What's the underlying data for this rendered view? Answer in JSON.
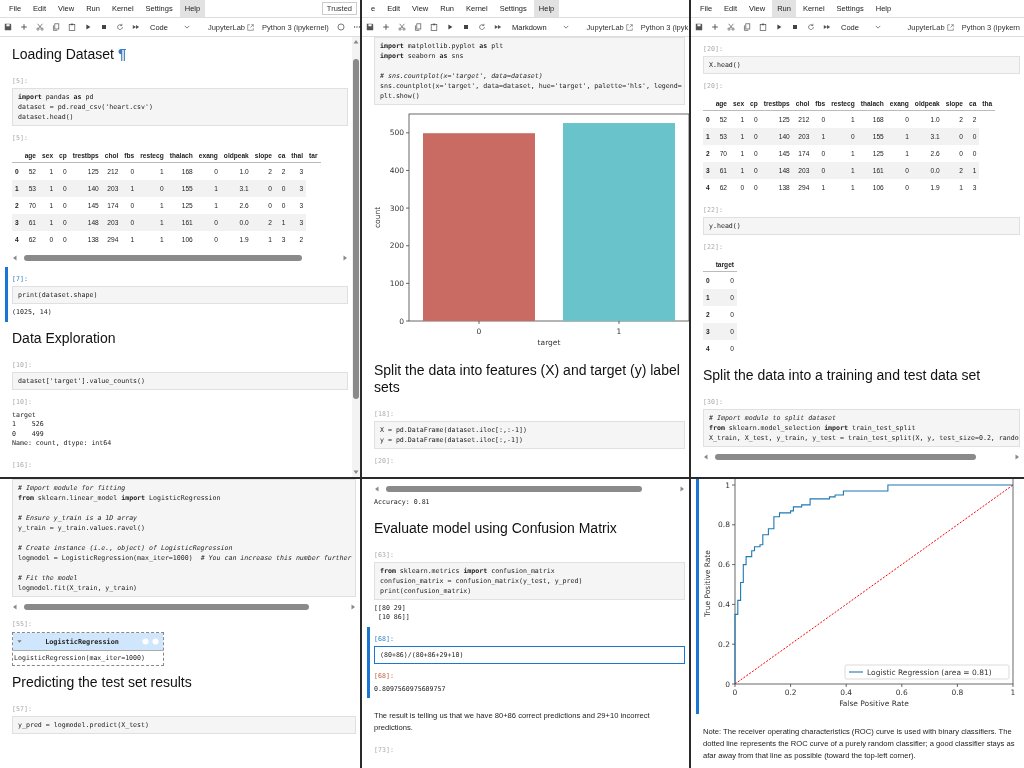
{
  "panels": [
    {
      "menu": {
        "items": [
          {
            "label": "File",
            "selected": false
          },
          {
            "label": "Edit",
            "selected": false
          },
          {
            "label": "View",
            "selected": false
          },
          {
            "label": "Run",
            "selected": false
          },
          {
            "label": "Kernel",
            "selected": false
          },
          {
            "label": "Settings",
            "selected": false
          },
          {
            "label": "Help",
            "selected": true
          }
        ],
        "trusted": "Trusted"
      },
      "toolbar": {
        "cell_type": "Code",
        "open_label": "JupyterLab",
        "kernel": "Python 3 (ipykernel)",
        "indicator": true
      },
      "scrollbar": true,
      "cells": [
        {
          "selected": false,
          "blocks": [
            {
              "kind": "heading",
              "text": "Loading Dataset",
              "anchor": "¶"
            }
          ]
        },
        {
          "selected": false,
          "blocks": [
            {
              "kind": "in_prompt",
              "text": "[5]:"
            },
            {
              "kind": "code",
              "groups": [
                [
                  "**import** pandas **as** pd",
                  "dataset = pd.read_csv('heart.csv')",
                  "dataset.head()"
                ]
              ]
            },
            {
              "kind": "out_prompt",
              "text": "[5]:"
            },
            {
              "kind": "table",
              "columns": [
                "age",
                "sex",
                "cp",
                "trestbps",
                "chol",
                "fbs",
                "restecg",
                "thalach",
                "exang",
                "oldpeak",
                "slope",
                "ca",
                "thal",
                "tar"
              ],
              "rows": [
                {
                  "index": "0",
                  "cells": [
                    "52",
                    "1",
                    "0",
                    "125",
                    "212",
                    "0",
                    "1",
                    "168",
                    "0",
                    "1.0",
                    "2",
                    "2",
                    "3"
                  ]
                },
                {
                  "index": "1",
                  "cells": [
                    "53",
                    "1",
                    "0",
                    "140",
                    "203",
                    "1",
                    "0",
                    "155",
                    "1",
                    "3.1",
                    "0",
                    "0",
                    "3"
                  ]
                },
                {
                  "index": "2",
                  "cells": [
                    "70",
                    "1",
                    "0",
                    "145",
                    "174",
                    "0",
                    "1",
                    "125",
                    "1",
                    "2.6",
                    "0",
                    "0",
                    "3"
                  ]
                },
                {
                  "index": "3",
                  "cells": [
                    "61",
                    "1",
                    "0",
                    "148",
                    "203",
                    "0",
                    "1",
                    "161",
                    "0",
                    "0.0",
                    "2",
                    "1",
                    "3"
                  ]
                },
                {
                  "index": "4",
                  "cells": [
                    "62",
                    "0",
                    "0",
                    "138",
                    "294",
                    "1",
                    "1",
                    "106",
                    "0",
                    "1.9",
                    "1",
                    "3",
                    "2"
                  ]
                }
              ]
            },
            {
              "kind": "hscroll"
            }
          ]
        },
        {
          "selected": true,
          "blocks": [
            {
              "kind": "in_prompt",
              "text": "[7]:"
            },
            {
              "kind": "code",
              "groups": [
                [
                  "print(dataset.shape)"
                ]
              ]
            },
            {
              "kind": "output",
              "lines": [
                "(1025, 14)"
              ]
            }
          ]
        },
        {
          "selected": false,
          "blocks": [
            {
              "kind": "heading",
              "text": "Data Exploration"
            }
          ]
        },
        {
          "selected": false,
          "blocks": [
            {
              "kind": "in_prompt",
              "text": "[10]:"
            },
            {
              "kind": "code",
              "groups": [
                [
                  "dataset['target'].value_counts()"
                ]
              ]
            },
            {
              "kind": "out_prompt",
              "text": "[10]:"
            },
            {
              "kind": "output",
              "lines": [
                "target",
                "1    526",
                "0    499",
                "Name: count, dtype: int64"
              ]
            }
          ]
        },
        {
          "selected": false,
          "blocks": [
            {
              "kind": "in_prompt",
              "text": "[16]:"
            }
          ]
        }
      ]
    },
    {
      "menu": {
        "items": [
          {
            "label": "e",
            "selected": false
          },
          {
            "label": "Edit",
            "selected": false
          },
          {
            "label": "View",
            "selected": false
          },
          {
            "label": "Run",
            "selected": false
          },
          {
            "label": "Kernel",
            "selected": false
          },
          {
            "label": "Settings",
            "selected": false
          },
          {
            "label": "Help",
            "selected": true
          }
        ]
      },
      "toolbar": {
        "cell_type": "Markdown",
        "open_label": "JupyterLab",
        "kernel": "Python 3 (ipyk"
      },
      "cells": [
        {
          "selected": false,
          "blocks": [
            {
              "kind": "code",
              "groups": [
                [
                  "**import** matplotlib.pyplot **as** plt",
                  "**import** seaborn **as** sns"
                ],
                [
                  "*# sns.countplot(x='target', data=dataset)*",
                  "sns.countplot(x='target', data=dataset, hue='target', palette='hls', legend=",
                  "plt.show()"
                ]
              ]
            },
            {
              "kind": "chart",
              "chart_data": {
                "type": "bar",
                "xlabel": "target",
                "ylabel": "count",
                "categories": [
                  "0",
                  "1"
                ],
                "series": [
                  {
                    "color": "#c96a63",
                    "values": [
                      499,
                      null
                    ]
                  },
                  {
                    "color": "#68c4ca",
                    "values": [
                      null,
                      526
                    ]
                  }
                ],
                "ylim": [
                  0,
                  550
                ],
                "yticks": [
                  0,
                  100,
                  200,
                  300,
                  400,
                  500
                ]
              }
            }
          ]
        },
        {
          "selected": false,
          "blocks": [
            {
              "kind": "heading",
              "text": "Split the data into features (X) and target (y) label sets"
            }
          ]
        },
        {
          "selected": false,
          "blocks": [
            {
              "kind": "in_prompt",
              "text": "[18]:"
            },
            {
              "kind": "code",
              "groups": [
                [
                  "X = pd.DataFrame(dataset.iloc[:,:-1])",
                  "y = pd.DataFrame(dataset.iloc[:,-1])"
                ]
              ]
            }
          ]
        },
        {
          "selected": false,
          "blocks": [
            {
              "kind": "in_prompt",
              "text": "[20]:"
            }
          ]
        }
      ]
    },
    {
      "menu": {
        "items": [
          {
            "label": "File",
            "selected": false
          },
          {
            "label": "Edit",
            "selected": false
          },
          {
            "label": "View",
            "selected": false
          },
          {
            "label": "Run",
            "selected": true
          },
          {
            "label": "Kernel",
            "selected": false
          },
          {
            "label": "Settings",
            "selected": false
          },
          {
            "label": "Help",
            "selected": false
          }
        ]
      },
      "toolbar": {
        "cell_type": "Code",
        "open_label": "JupyterLab",
        "kernel": "Python 3 (ipykern"
      },
      "cells": [
        {
          "selected": false,
          "blocks": [
            {
              "kind": "in_prompt",
              "text": "[20]:"
            },
            {
              "kind": "code",
              "groups": [
                [
                  "X.head()"
                ]
              ]
            },
            {
              "kind": "out_prompt",
              "text": "[20]:"
            },
            {
              "kind": "table",
              "columns": [
                "age",
                "sex",
                "cp",
                "trestbps",
                "chol",
                "fbs",
                "restecg",
                "thalach",
                "exang",
                "oldpeak",
                "slope",
                "ca",
                "tha"
              ],
              "rows": [
                {
                  "index": "0",
                  "cells": [
                    "52",
                    "1",
                    "0",
                    "125",
                    "212",
                    "0",
                    "1",
                    "168",
                    "0",
                    "1.0",
                    "2",
                    "2"
                  ]
                },
                {
                  "index": "1",
                  "cells": [
                    "53",
                    "1",
                    "0",
                    "140",
                    "203",
                    "1",
                    "0",
                    "155",
                    "1",
                    "3.1",
                    "0",
                    "0"
                  ]
                },
                {
                  "index": "2",
                  "cells": [
                    "70",
                    "1",
                    "0",
                    "145",
                    "174",
                    "0",
                    "1",
                    "125",
                    "1",
                    "2.6",
                    "0",
                    "0"
                  ]
                },
                {
                  "index": "3",
                  "cells": [
                    "61",
                    "1",
                    "0",
                    "148",
                    "203",
                    "0",
                    "1",
                    "161",
                    "0",
                    "0.0",
                    "2",
                    "1"
                  ]
                },
                {
                  "index": "4",
                  "cells": [
                    "62",
                    "0",
                    "0",
                    "138",
                    "294",
                    "1",
                    "1",
                    "106",
                    "0",
                    "1.9",
                    "1",
                    "3"
                  ]
                }
              ]
            }
          ]
        },
        {
          "selected": false,
          "blocks": [
            {
              "kind": "in_prompt",
              "text": "[22]:"
            },
            {
              "kind": "code",
              "groups": [
                [
                  "y.head()"
                ]
              ]
            },
            {
              "kind": "out_prompt",
              "text": "[22]:"
            },
            {
              "kind": "table",
              "columns": [
                "target"
              ],
              "rows": [
                {
                  "index": "0",
                  "cells": [
                    "0"
                  ]
                },
                {
                  "index": "1",
                  "cells": [
                    "0"
                  ]
                },
                {
                  "index": "2",
                  "cells": [
                    "0"
                  ]
                },
                {
                  "index": "3",
                  "cells": [
                    "0"
                  ]
                },
                {
                  "index": "4",
                  "cells": [
                    "0"
                  ]
                }
              ]
            }
          ]
        },
        {
          "selected": false,
          "blocks": [
            {
              "kind": "heading",
              "text": "Split the data into a training and test data set"
            }
          ]
        },
        {
          "selected": false,
          "blocks": [
            {
              "kind": "in_prompt",
              "text": "[30]:"
            },
            {
              "kind": "code",
              "groups": [
                [
                  "*# Import module to split dataset*",
                  "**from** sklearn.model_selection **import** train_test_split",
                  "X_train, X_test, y_train, y_test = train_test_split(X, y, test_size=0.2, rando"
                ]
              ]
            },
            {
              "kind": "hscroll"
            }
          ]
        }
      ]
    },
    {
      "cells": [
        {
          "selected": false,
          "blocks": [
            {
              "kind": "code",
              "groups": [
                [
                  "*# Import module for fitting*",
                  "**from** sklearn.linear_model **import** LogisticRegression"
                ],
                [
                  "*# Ensure y_train is a 1D array*",
                  "y_train = y_train.values.ravel()"
                ],
                [
                  "*# Create instance (i.e., object) of LogisticRegression*",
                  "logmodel = LogisticRegression(max_iter=1000)  *# You can increase this number further*"
                ],
                [
                  "*# Fit the model*",
                  "logmodel.fit(X_train, y_train)"
                ]
              ]
            },
            {
              "kind": "hscroll"
            },
            {
              "kind": "out_prompt",
              "text": "[55]:"
            },
            {
              "kind": "widget",
              "title": "LogisticRegression",
              "body": "LogisticRegression(max_iter=1000)"
            }
          ]
        },
        {
          "selected": false,
          "blocks": [
            {
              "kind": "heading",
              "text": "Predicting the test set results"
            }
          ]
        },
        {
          "selected": false,
          "blocks": [
            {
              "kind": "in_prompt",
              "text": "[57]:"
            },
            {
              "kind": "code",
              "groups": [
                [
                  "y_pred = logmodel.predict(X_test)"
                ]
              ]
            }
          ]
        }
      ]
    },
    {
      "cells": [
        {
          "selected": false,
          "blocks": [
            {
              "kind": "hscroll"
            },
            {
              "kind": "output",
              "lines": [
                "Accuracy: 0.81"
              ]
            }
          ]
        },
        {
          "selected": false,
          "blocks": [
            {
              "kind": "heading",
              "text": "Evaluate model using Confusion Matrix"
            }
          ]
        },
        {
          "selected": false,
          "blocks": [
            {
              "kind": "in_prompt",
              "text": "[63]:"
            },
            {
              "kind": "code",
              "groups": [
                [
                  "**from** sklearn.metrics **import** confusion_matrix",
                  "confusion_matrix = confusion_matrix(y_test, y_pred)",
                  "print(confusion_matrix)"
                ]
              ]
            },
            {
              "kind": "output",
              "lines": [
                "[[80 29]",
                " [10 86]]"
              ]
            }
          ]
        },
        {
          "selected": true,
          "blocks": [
            {
              "kind": "in_prompt",
              "text": "[68]:"
            },
            {
              "kind": "code",
              "focused": true,
              "groups": [
                [
                  "(80+86)/(80+86+29+10)"
                ]
              ]
            },
            {
              "kind": "out_prompt",
              "text": "[68]:"
            },
            {
              "kind": "output",
              "lines": [
                "0.8097560975609757"
              ]
            }
          ]
        },
        {
          "selected": false,
          "blocks": [
            {
              "kind": "text",
              "text": "The result is telling us that we have 80+86 correct predictions and 29+10 incorrect predictions."
            }
          ]
        },
        {
          "selected": false,
          "blocks": [
            {
              "kind": "in_prompt",
              "text": "[73]:"
            }
          ]
        }
      ]
    },
    {
      "cells": [
        {
          "selected": true,
          "blocks": [
            {
              "kind": "chart",
              "chart_data": {
                "type": "line",
                "xlabel": "False Positive Rate",
                "ylabel": "True Positive Rate",
                "xlim": [
                  0,
                  1
                ],
                "ylim": [
                  0,
                  1.05
                ],
                "xticks": [
                  0,
                  0.2,
                  0.4,
                  0.6,
                  0.8,
                  1
                ],
                "yticks": [
                  0,
                  0.2,
                  0.4,
                  0.6,
                  0.8,
                  1
                ],
                "x": [
                  0,
                  0,
                  0.01,
                  0.01,
                  0.02,
                  0.02,
                  0.03,
                  0.03,
                  0.04,
                  0.04,
                  0.06,
                  0.06,
                  0.07,
                  0.07,
                  0.09,
                  0.09,
                  0.1,
                  0.1,
                  0.12,
                  0.12,
                  0.14,
                  0.14,
                  0.16,
                  0.16,
                  0.2,
                  0.2,
                  0.21,
                  0.21,
                  0.24,
                  0.24,
                  0.27,
                  0.27,
                  0.34,
                  0.34,
                  0.36,
                  0.36,
                  0.39,
                  0.39,
                  0.55,
                  0.55,
                  1
                ],
                "series": [
                  {
                    "name": "Logistic Regression (area = 0.81)",
                    "color": "#1f77b4",
                    "line_style": "solid",
                    "values": [
                      0,
                      0.35,
                      0.35,
                      0.42,
                      0.42,
                      0.51,
                      0.51,
                      0.6,
                      0.6,
                      0.64,
                      0.64,
                      0.67,
                      0.67,
                      0.69,
                      0.69,
                      0.7,
                      0.7,
                      0.75,
                      0.75,
                      0.78,
                      0.78,
                      0.84,
                      0.84,
                      0.86,
                      0.86,
                      0.87,
                      0.87,
                      0.89,
                      0.89,
                      0.9,
                      0.9,
                      0.93,
                      0.93,
                      0.94,
                      0.94,
                      0.95,
                      0.95,
                      0.97,
                      0.97,
                      1,
                      1
                    ]
                  },
                  {
                    "color": "#ff0000",
                    "line_style": "dashed",
                    "values": [
                      0,
                      0,
                      0.01,
                      0.01,
                      0.02,
                      0.02,
                      0.03,
                      0.03,
                      0.04,
                      0.04,
                      0.06,
                      0.06,
                      0.07,
                      0.07,
                      0.09,
                      0.09,
                      0.1,
                      0.1,
                      0.12,
                      0.12,
                      0.14,
                      0.14,
                      0.16,
                      0.16,
                      0.2,
                      0.2,
                      0.21,
                      0.21,
                      0.24,
                      0.24,
                      0.27,
                      0.27,
                      0.34,
                      0.34,
                      0.36,
                      0.36,
                      0.39,
                      0.39,
                      0.55,
                      0.55,
                      1
                    ]
                  }
                ]
              }
            }
          ]
        },
        {
          "selected": false,
          "blocks": [
            {
              "kind": "text",
              "text": "Note: The receiver operating characteristics (ROC) curve is used with binary classifiers. The dotted line represents the ROC curve of a purely random classifier; a good classifier stays as afar away from that line as possible (toward the top-left corner)."
            }
          ]
        }
      ]
    }
  ]
}
